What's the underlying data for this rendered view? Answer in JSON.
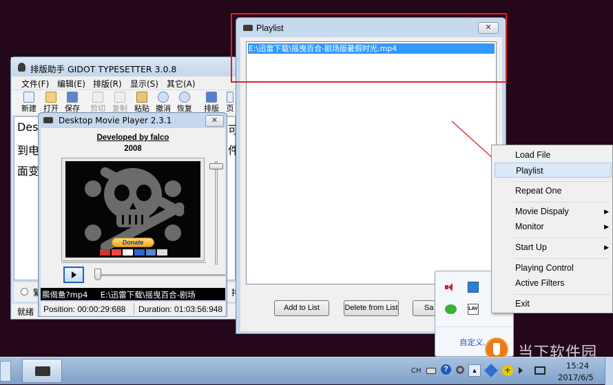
{
  "typesetter": {
    "title": "排版助手 GIDOT TYPESETTER 3.0.8",
    "menu": [
      "文件(F)",
      "编辑(E)",
      "排版(R)",
      "显示(S)",
      "其它(A)"
    ],
    "toolbar": [
      "新建",
      "打开",
      "保存",
      "剪切",
      "复制",
      "粘贴",
      "撤消",
      "恢复",
      "排版",
      "页"
    ],
    "doc_lines": [
      "Des",
      "到电",
      "面变"
    ],
    "side_chars": [
      "可",
      "件"
    ],
    "status": "就绪",
    "radio_char": "繁",
    "side_bottom": "排"
  },
  "player": {
    "title": "Desktop Movie Player 2.3.1",
    "close": "✕",
    "credit": "Developed by falco",
    "year": "2008",
    "donate": "Donate",
    "play_icon": "play-icon",
    "marquee": "羆偈惫?mp4     E:\\迅雷下载\\摇曳百合-剧场",
    "position": "Position: 00:00:29:688",
    "duration": "Duration: 01:03:56:948",
    "volume_level": 0.02,
    "seek_level": 0.0
  },
  "playlist": {
    "title": "Playlist",
    "close": "✕",
    "items": [
      "E:\\迅雷下载\\摇曳百合-剧场版暑假时光.mp4"
    ],
    "buttons": [
      "Add to List",
      "Delete from List",
      "Sa"
    ]
  },
  "context_menu": {
    "items": [
      {
        "label": "Load File"
      },
      {
        "label": "Playlist"
      },
      {
        "label": "Repeat One"
      },
      {
        "label": "Movie Dispaly",
        "submenu": true
      },
      {
        "label": "Monitor",
        "submenu": true
      },
      {
        "label": "Start Up",
        "submenu": true
      },
      {
        "label": "Playing Control"
      },
      {
        "label": "Active Filters"
      },
      {
        "label": "Exit"
      }
    ]
  },
  "tray_popup": {
    "customize": "自定义..."
  },
  "taskbar": {
    "lang": "CH",
    "time": "15:24",
    "date": "2017/6/5"
  },
  "watermark": "当下软件园",
  "colors": {
    "highlight": "#cce8ff",
    "selection": "#3399ff",
    "annotation_red": "#e02020",
    "desktop": "#24081a"
  }
}
